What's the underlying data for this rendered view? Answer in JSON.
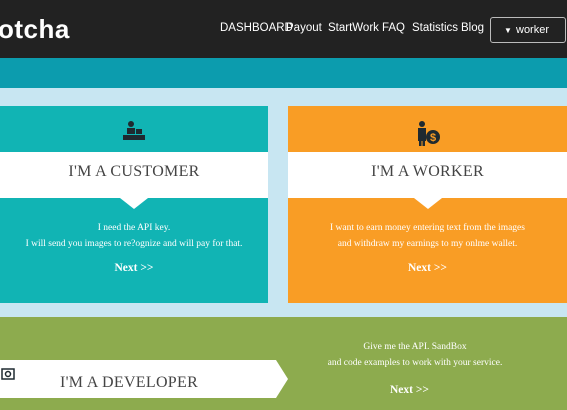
{
  "header": {
    "brand": "otcha",
    "nav": [
      "DASHBOARD",
      "Payout",
      "StartWork",
      "FAQ",
      "Statistics",
      "Blog"
    ],
    "role_dropdown": "worker"
  },
  "cards": {
    "customer": {
      "title": "I'M A CUSTOMER",
      "desc_line1": "I need the API key.",
      "desc_line2": "I will send you images to re?ognize and will pay for that.",
      "next": "Next >>"
    },
    "worker": {
      "title": "I'M A WORKER",
      "desc_line1": "I want to earn money entering text from the images",
      "desc_line2": "and withdraw my earnings to my onlme wallet.",
      "next": "Next >>"
    },
    "developer": {
      "title": "I'M A DEVELOPER",
      "desc_line1": "Give me the API. SandBox",
      "desc_line2": "and code examples to work with your service.",
      "next": "Next >>"
    }
  },
  "colors": {
    "header": "#222222",
    "teal_band": "#0c9cae",
    "customer": "#11b4b4",
    "worker": "#f99d25",
    "developer": "#8dab4e",
    "background": "#c8e6f2"
  }
}
